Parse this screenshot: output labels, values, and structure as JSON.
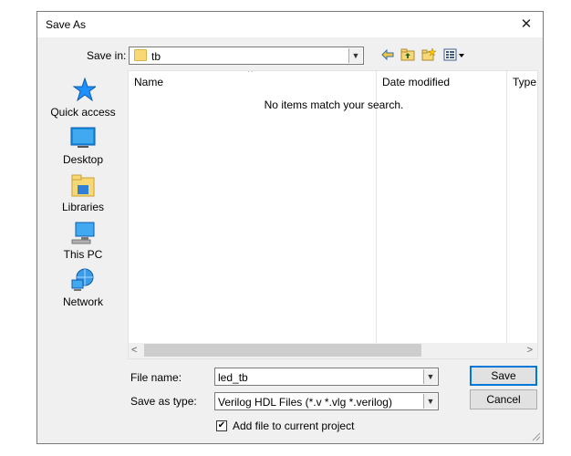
{
  "window": {
    "title": "Save As",
    "close_icon": "close-icon"
  },
  "save_in": {
    "label": "Save in:",
    "value": "tb"
  },
  "toolbar": {
    "icons": [
      "back-icon",
      "up-folder-icon",
      "new-folder-icon",
      "view-menu-icon"
    ]
  },
  "places": [
    {
      "label": "Quick access",
      "icon": "quick-access-star-icon"
    },
    {
      "label": "Desktop",
      "icon": "desktop-icon"
    },
    {
      "label": "Libraries",
      "icon": "libraries-icon"
    },
    {
      "label": "This PC",
      "icon": "this-pc-icon"
    },
    {
      "label": "Network",
      "icon": "network-icon"
    }
  ],
  "filelist": {
    "columns": [
      "Name",
      "Date modified",
      "Type"
    ],
    "empty_message": "No items match your search."
  },
  "file_name": {
    "label": "File name:",
    "value": "led_tb"
  },
  "save_as_type": {
    "label": "Save as type:",
    "value": "Verilog HDL Files (*.v *.vlg *.verilog)"
  },
  "buttons": {
    "save": "Save",
    "cancel": "Cancel"
  },
  "add_to_project": {
    "label": "Add file to current project",
    "checked": true
  },
  "colors": {
    "accent": "#0078d7",
    "dialog_bg": "#f0f0f0",
    "folder": "#f8d775"
  }
}
